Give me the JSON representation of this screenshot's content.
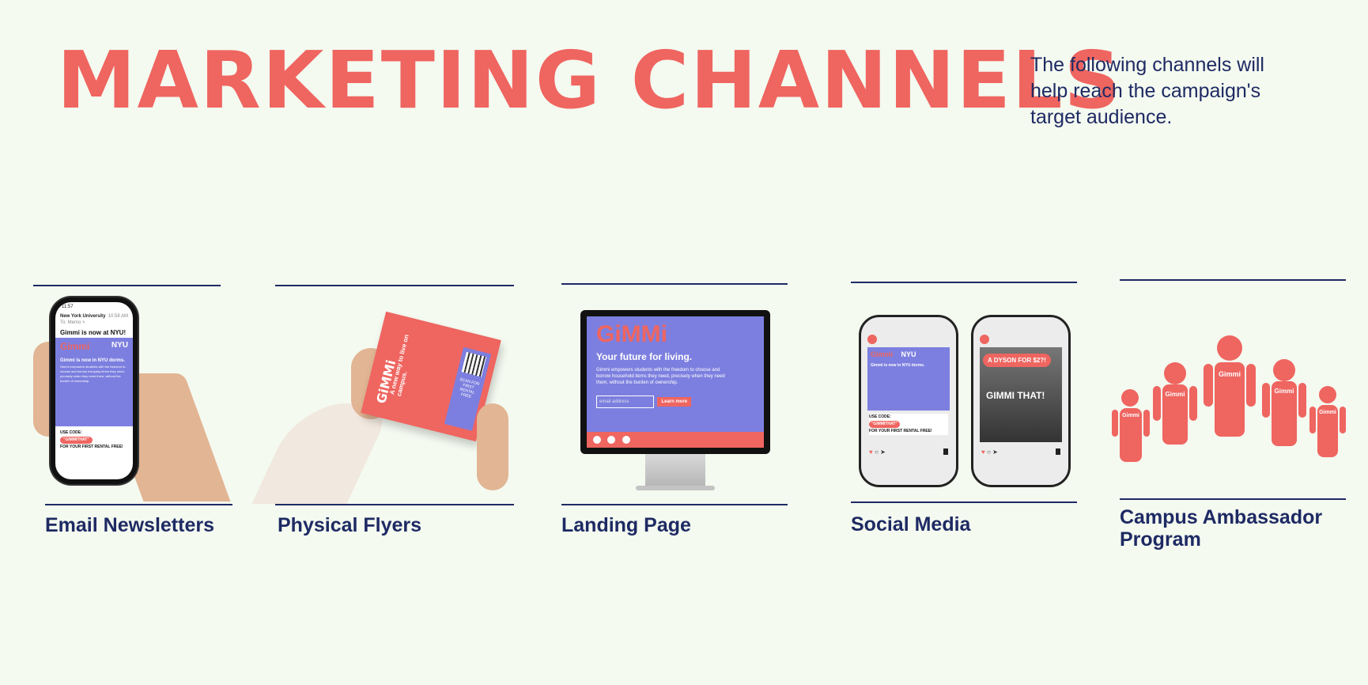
{
  "page": {
    "title": "MARKETING CHANNELS",
    "subtitle": "The following channels will help reach the campaign's target audience."
  },
  "colors": {
    "background": "#f4faf0",
    "accent": "#ef6560",
    "navy": "#1e2a63",
    "purple": "#7c7fdf"
  },
  "channels": [
    {
      "label": "Email Newsletters"
    },
    {
      "label": "Physical Flyers"
    },
    {
      "label": "Landing Page"
    },
    {
      "label": "Social Media"
    },
    {
      "label": "Campus Ambassador Program"
    }
  ],
  "email_mock": {
    "status_time": "11:57",
    "sender": "New York University",
    "to": "To: Memo >",
    "date": "10:58 AM",
    "subject": "Gimmi is now at NYU!",
    "brand": "Gimmi",
    "partner": "NYU",
    "heading": "Gimmi is now in NYU dorms.",
    "body": "Gimmi empowers students with the freedom to choose and borrow everyday items they need, precisely when they need them, without the burden of ownership.",
    "code_label": "USE CODE:",
    "code": "\"GIMMITHAT\"",
    "offer": "FOR YOUR FIRST RENTAL FREE!"
  },
  "flyer_mock": {
    "brand": "GiMMi",
    "tagline": "A new way to live on campus.",
    "scan_text": "SCAN FOR FIRST RENTAL FREE"
  },
  "landing_mock": {
    "brand": "GiMMi",
    "headline": "Your future for living.",
    "body": "Gimmi empowers students with the freedom to choose and borrow household items they need, precisely when they need them, without the burden of ownership.",
    "email_placeholder": "email address",
    "cta": "Learn more"
  },
  "social_mock": {
    "post1": {
      "brand": "Gimmi",
      "partner": "NYU",
      "heading": "Gimmi is now in NYU dorms.",
      "code_label": "USE CODE:",
      "code": "\"GIMMITHAT\"",
      "offer": "FOR YOUR FIRST RENTAL FREE!"
    },
    "post2": {
      "badge": "A DYSON FOR $2?!",
      "caption": "GIMMI THAT!"
    }
  },
  "ambassador_mock": {
    "shirt_text": "Gimmi"
  }
}
